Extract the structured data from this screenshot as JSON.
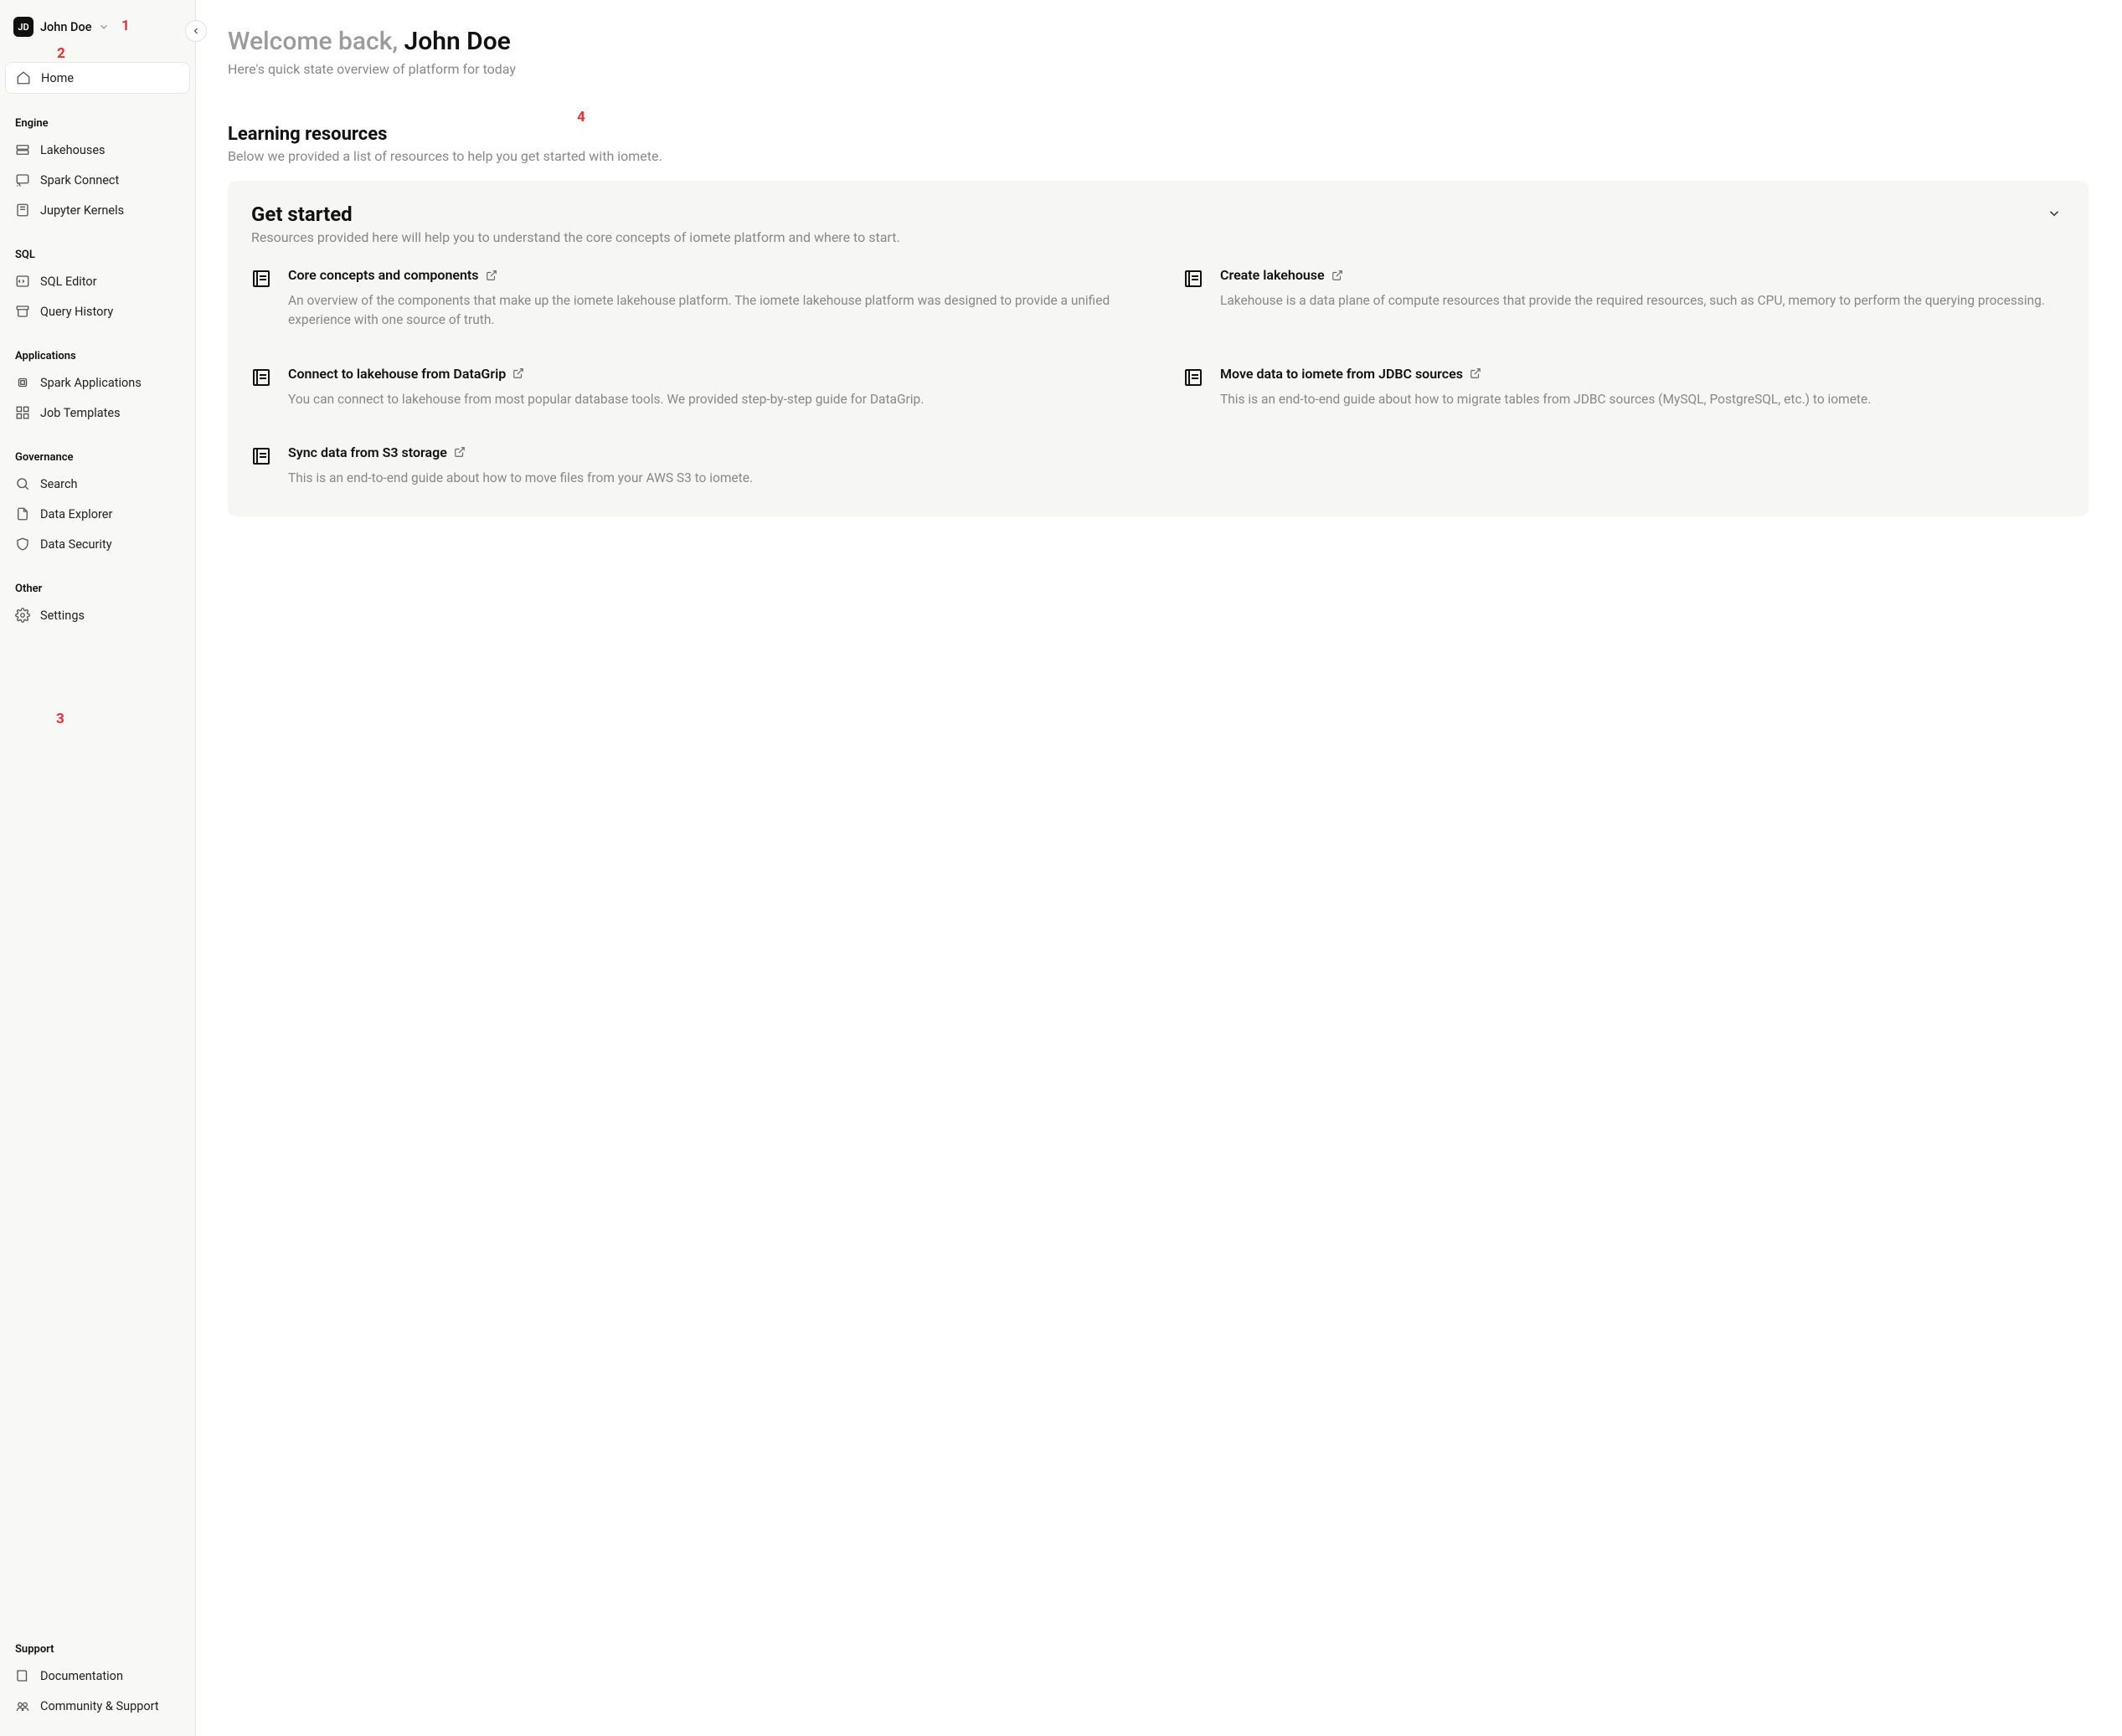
{
  "user": {
    "initials": "JD",
    "name": "John Doe"
  },
  "sidebar": {
    "home": "Home",
    "sections": {
      "engine": {
        "label": "Engine",
        "items": [
          "Lakehouses",
          "Spark Connect",
          "Jupyter Kernels"
        ]
      },
      "sql": {
        "label": "SQL",
        "items": [
          "SQL Editor",
          "Query History"
        ]
      },
      "applications": {
        "label": "Applications",
        "items": [
          "Spark Applications",
          "Job Templates"
        ]
      },
      "governance": {
        "label": "Governance",
        "items": [
          "Search",
          "Data Explorer",
          "Data Security"
        ]
      },
      "other": {
        "label": "Other",
        "items": [
          "Settings"
        ]
      },
      "support": {
        "label": "Support",
        "items": [
          "Documentation",
          "Community & Support"
        ]
      }
    }
  },
  "welcome": {
    "prefix": "Welcome back, ",
    "name": "John Doe",
    "subtitle": "Here's quick state overview of platform for today"
  },
  "learning": {
    "title": "Learning resources",
    "subtitle": "Below we provided a list of resources to help you get started with iomete."
  },
  "panel": {
    "title": "Get started",
    "subtitle": "Resources provided here will help you to understand the core concepts of iomete platform and where to start."
  },
  "resources": [
    {
      "title": "Core concepts and components",
      "desc": "An overview of the components that make up the iomete lakehouse platform. The iomete lakehouse platform was designed to provide a unified experience with one source of truth."
    },
    {
      "title": "Create lakehouse",
      "desc": "Lakehouse is a data plane of compute resources that provide the required resources, such as CPU, memory to perform the querying processing."
    },
    {
      "title": "Connect to lakehouse from DataGrip",
      "desc": "You can connect to lakehouse from most popular database tools. We provided step-by-step guide for DataGrip."
    },
    {
      "title": "Move data to iomete from JDBC sources",
      "desc": "This is an end-to-end guide about how to migrate tables from JDBC sources (MySQL, PostgreSQL, etc.) to iomete."
    },
    {
      "title": "Sync data from S3 storage",
      "desc": "This is an end-to-end guide about how to move files from your AWS S3 to iomete."
    }
  ],
  "annotations": {
    "a1": "1",
    "a2": "2",
    "a3": "3",
    "a4": "4"
  }
}
